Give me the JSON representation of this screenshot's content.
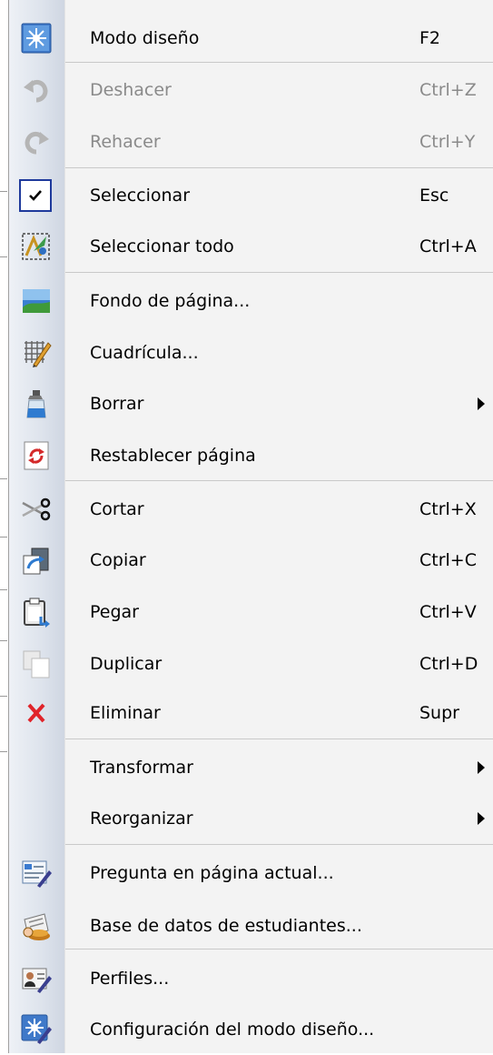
{
  "menu": {
    "items": [
      {
        "label": "Modo diseño",
        "shortcut": "F2",
        "icon": "design-mode-icon"
      },
      {
        "label": "Deshacer",
        "shortcut": "Ctrl+Z",
        "icon": "undo-icon",
        "disabled": true
      },
      {
        "label": "Rehacer",
        "shortcut": "Ctrl+Y",
        "icon": "redo-icon",
        "disabled": true
      },
      {
        "label": "Seleccionar",
        "shortcut": "Esc",
        "icon": "check-icon",
        "checked": true
      },
      {
        "label": "Seleccionar todo",
        "shortcut": "Ctrl+A",
        "icon": "select-all-icon"
      },
      {
        "label": "Fondo de página...",
        "shortcut": "",
        "icon": "page-background-icon"
      },
      {
        "label": "Cuadrícula...",
        "shortcut": "",
        "icon": "grid-icon"
      },
      {
        "label": "Borrar",
        "shortcut": "",
        "icon": "clear-spray-icon",
        "submenu": true
      },
      {
        "label": "Restablecer página",
        "shortcut": "",
        "icon": "reset-page-icon"
      },
      {
        "label": "Cortar",
        "shortcut": "Ctrl+X",
        "icon": "scissors-icon"
      },
      {
        "label": "Copiar",
        "shortcut": "Ctrl+C",
        "icon": "copy-icon"
      },
      {
        "label": "Pegar",
        "shortcut": "Ctrl+V",
        "icon": "paste-icon"
      },
      {
        "label": "Duplicar",
        "shortcut": "Ctrl+D",
        "icon": "duplicate-icon"
      },
      {
        "label": "Eliminar",
        "shortcut": "Supr",
        "icon": "delete-x-icon"
      },
      {
        "label": "Transformar",
        "shortcut": "",
        "icon": "",
        "submenu": true
      },
      {
        "label": "Reorganizar",
        "shortcut": "",
        "icon": "",
        "submenu": true
      },
      {
        "label": "Pregunta en página actual...",
        "shortcut": "",
        "icon": "question-page-icon"
      },
      {
        "label": "Base de datos de estudiantes...",
        "shortcut": "",
        "icon": "student-database-icon"
      },
      {
        "label": "Perfiles...",
        "shortcut": "",
        "icon": "profiles-icon"
      },
      {
        "label": "Configuración del modo diseño...",
        "shortcut": "",
        "icon": "design-settings-icon"
      }
    ]
  }
}
